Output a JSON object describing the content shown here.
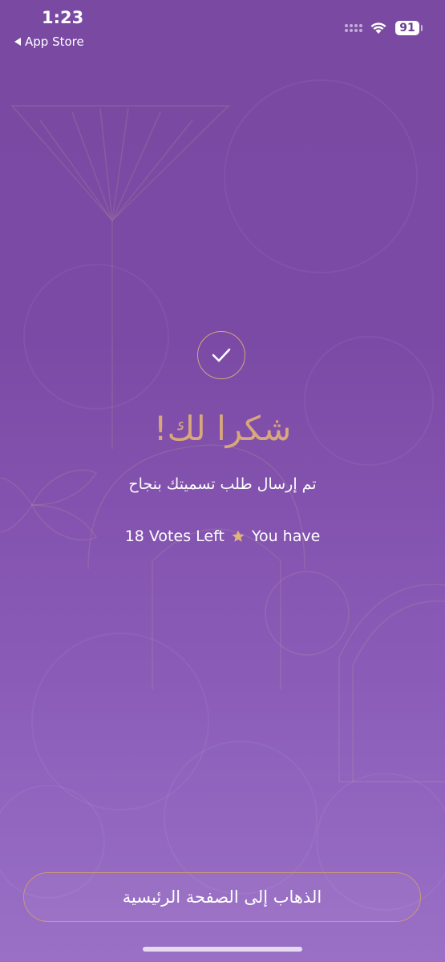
{
  "status_bar": {
    "time": "1:23",
    "back_label": "App Store",
    "battery": "91"
  },
  "confirmation": {
    "title": "شكرا لك!",
    "message": "تم إرسال طلب تسميتك بنجاح",
    "votes_left": "18 Votes Left",
    "you_have": "You have"
  },
  "footer": {
    "home_button_label": "الذهاب إلى الصفحة الرئيسية"
  },
  "colors": {
    "accent_gold": "#d8a77c",
    "background_purple": "#7a4aa2"
  }
}
